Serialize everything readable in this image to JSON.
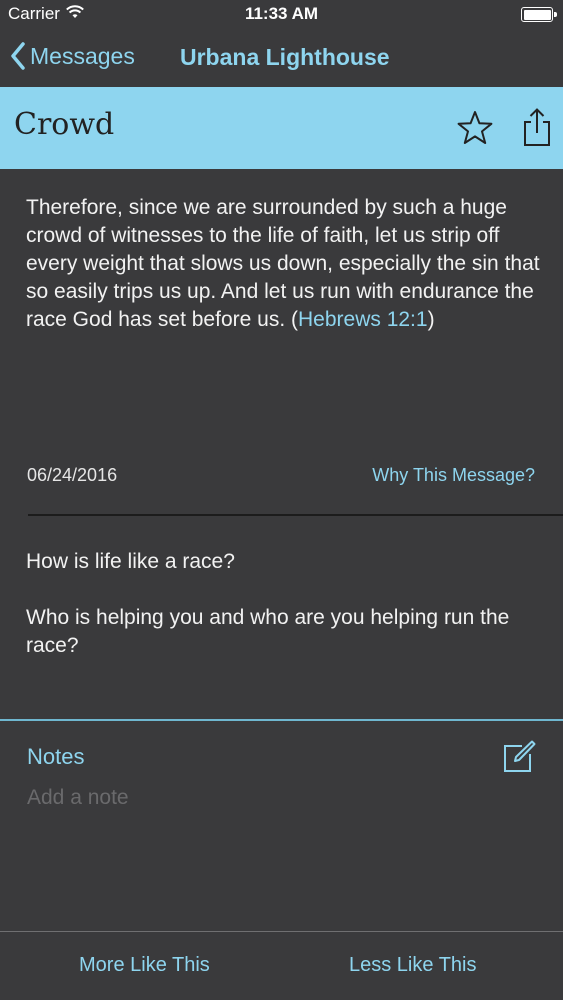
{
  "status_bar": {
    "carrier": "Carrier",
    "time": "11:33 AM"
  },
  "nav": {
    "back_label": "Messages",
    "title": "Urbana Lighthouse"
  },
  "message": {
    "title": "Crowd",
    "verse_text": "Therefore, since we are surrounded by such a huge crowd of witnesses to the life of faith, let us strip off every weight that slows us down, especially the sin that so easily trips us up. And let us run with endurance the race God has set before us.",
    "verse_open": "(",
    "verse_ref": "Hebrews 12:1",
    "verse_close": ")",
    "date": "06/24/2016",
    "why_link": "Why This Message?"
  },
  "questions": [
    "How is life like a race?",
    "Who is helping you and who are you helping run the race?"
  ],
  "notes": {
    "title": "Notes",
    "placeholder": "Add a note"
  },
  "bottom": {
    "more_label": "More Like This",
    "less_label": "Less Like This"
  },
  "colors": {
    "accent": "#8ed5ef",
    "background": "#3a3a3c",
    "header_band": "#8ed5ef"
  }
}
